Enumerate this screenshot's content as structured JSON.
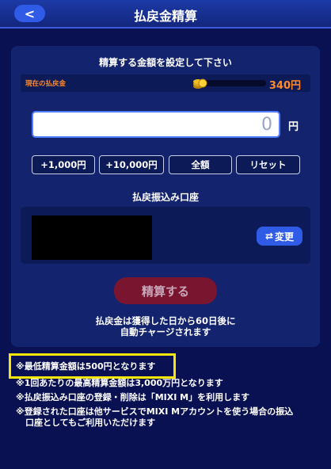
{
  "header": {
    "title": "払戻金精算",
    "back_symbol": "<"
  },
  "panel": {
    "subtitle": "精算する金額を設定して下さい",
    "balance": {
      "label": "現在の払戻金",
      "value": "340円"
    },
    "amount": {
      "value": "0",
      "unit": "円"
    },
    "quick_buttons": [
      "+1,000円",
      "+10,000円",
      "全額",
      "リセット"
    ],
    "account_section_title": "払戻振込み口座",
    "change_button": {
      "icon": "⇄",
      "label": "変更"
    },
    "submit_label": "精算する",
    "note_line1": "払戻金は獲得した日から60日後に",
    "note_line2": "自動チャージされます"
  },
  "notes": [
    "※最低精算金額は500円となります",
    "※1回あたりの最高精算金額は3,000万円となります",
    "※払戻振込み口座の登録・削除は「MIXI M」を利用します",
    "※登録された口座は他サービスでMIXI Mアカウントを使う場合の振込",
    "口座としてもご利用いただけます"
  ],
  "colors": {
    "accent": "#2f5be6",
    "balance": "#ff8a2a",
    "highlight": "#f5e70a",
    "submit": "#7a1530"
  }
}
